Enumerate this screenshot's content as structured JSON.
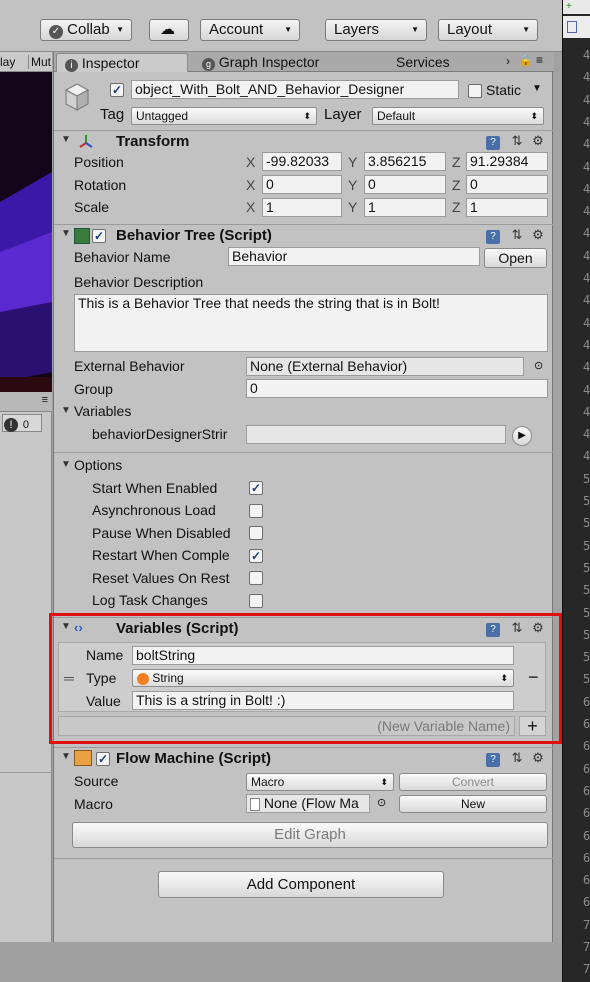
{
  "toolbar": {
    "collab_label": "Collab",
    "account_label": "Account",
    "layers_label": "Layers",
    "layout_label": "Layout"
  },
  "left_panel": {
    "tab_play": "lay",
    "tab_mute": "Mut",
    "warning_count": "0"
  },
  "inspector": {
    "tabs": [
      "Inspector",
      "Graph Inspector",
      "Services"
    ],
    "object": {
      "name": "object_With_Bolt_AND_Behavior_Designer",
      "static_label": "Static",
      "tag_label": "Tag",
      "tag_value": "Untagged",
      "layer_label": "Layer",
      "layer_value": "Default"
    },
    "transform": {
      "title": "Transform",
      "position_label": "Position",
      "rotation_label": "Rotation",
      "scale_label": "Scale",
      "axes": [
        "X",
        "Y",
        "Z"
      ],
      "position": [
        "-99.82033",
        "3.856215",
        "91.29384"
      ],
      "rotation": [
        "0",
        "0",
        "0"
      ],
      "scale": [
        "1",
        "1",
        "1"
      ]
    },
    "behavior_tree": {
      "title": "Behavior Tree (Script)",
      "name_label": "Behavior Name",
      "name_value": "Behavior",
      "open_button": "Open",
      "description_label": "Behavior Description",
      "description_value": "This is a Behavior Tree that needs the string that is in Bolt!",
      "external_label": "External Behavior",
      "external_value": "None (External Behavior)",
      "group_label": "Group",
      "group_value": "0",
      "variables_label": "Variables",
      "variable_name": "behaviorDesignerStrir",
      "options_label": "Options",
      "options": [
        {
          "label": "Start When Enabled",
          "checked": true
        },
        {
          "label": "Asynchronous Load",
          "checked": false
        },
        {
          "label": "Pause When Disabled",
          "checked": false
        },
        {
          "label": "Restart When Comple",
          "checked": true
        },
        {
          "label": "Reset Values On Rest",
          "checked": false
        },
        {
          "label": "Log Task Changes",
          "checked": false
        }
      ]
    },
    "variables_script": {
      "title": "Variables (Script)",
      "name_label": "Name",
      "name_value": "boltString",
      "type_label": "Type",
      "type_value": "String",
      "value_label": "Value",
      "value_value": "This is a string in Bolt! :)",
      "new_variable_placeholder": "(New Variable Name)",
      "add_symbol": "+",
      "remove_symbol": "−"
    },
    "flow_machine": {
      "title": "Flow Machine (Script)",
      "source_label": "Source",
      "source_value": "Macro",
      "convert_button": "Convert",
      "macro_label": "Macro",
      "macro_value": "None (Flow Ma",
      "new_button": "New",
      "edit_graph_button": "Edit Graph"
    },
    "add_component_button": "Add Component"
  },
  "right_strip": {
    "line_numbers": [
      "4",
      "4",
      "4",
      "4",
      "4",
      "4",
      "4",
      "4",
      "4",
      "4",
      "4",
      "4",
      "4",
      "4",
      "4",
      "4",
      "4",
      "4",
      "4",
      "5",
      "5",
      "5",
      "5",
      "5",
      "5",
      "5",
      "5",
      "5",
      "5",
      "6",
      "6",
      "6",
      "6",
      "6",
      "6",
      "6",
      "6",
      "6",
      "6",
      "7",
      "7",
      "7"
    ]
  },
  "colors": {
    "panel": "#c2c2c2",
    "highlight": "#e01010",
    "scene_bg": "#1a0a1e",
    "code_bg": "#272727"
  }
}
